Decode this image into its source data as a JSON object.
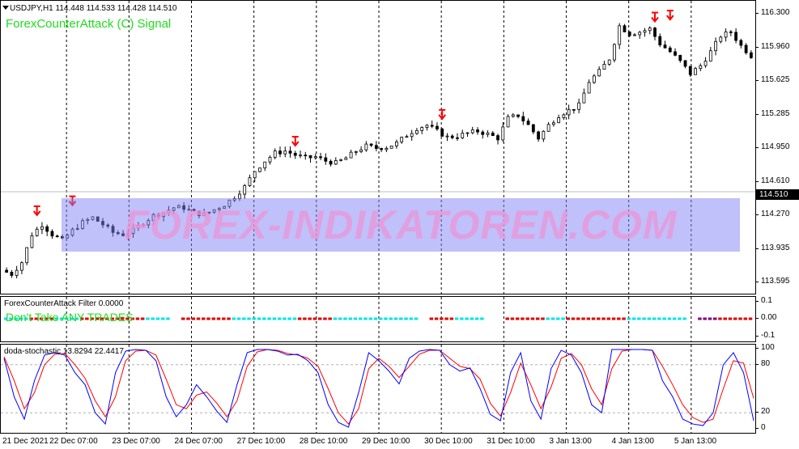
{
  "chart": {
    "symbol_title": "USDJPY,H1  114.448 114.533 114.428 114.510",
    "signal_title": "ForexCounterAttack (C) Signal",
    "watermark": "FOREX-INDIKATOREN.COM",
    "current_price": "114.510",
    "price_axis_labels": [
      "116.300",
      "115.960",
      "115.625",
      "115.285",
      "114.950",
      "114.610",
      "114.270",
      "113.935",
      "113.595"
    ]
  },
  "filter": {
    "title": "ForexCounterAttack Filter 0.0000",
    "message": "Don't Take ANY TRADES",
    "axis_labels": [
      "0.1",
      "0.00",
      "-0.1"
    ]
  },
  "stochastic": {
    "title": "doda-stochastic 13.8294 22.4417",
    "axis_labels": [
      "100",
      "80",
      "20",
      "0"
    ]
  },
  "time_axis": {
    "labels": [
      "21 Dec 2021",
      "22 Dec 07:00",
      "23 Dec 07:00",
      "24 Dec 07:00",
      "27 Dec 10:00",
      "28 Dec 10:00",
      "29 Dec 10:00",
      "30 Dec 10:00",
      "31 Dec 10:00",
      "3 Jan 13:00",
      "4 Jan 13:00",
      "5 Jan 13:00"
    ]
  },
  "chart_data": {
    "type": "candlestick",
    "symbol": "USDJPY",
    "timeframe": "H1",
    "ylim": [
      113.5,
      116.4
    ],
    "close_path": [
      [
        0,
        113.72
      ],
      [
        2,
        113.68
      ],
      [
        4,
        113.8
      ],
      [
        6,
        114.08
      ],
      [
        8,
        114.18
      ],
      [
        10,
        114.08
      ],
      [
        12,
        114.02
      ],
      [
        14,
        114.12
      ],
      [
        16,
        114.2
      ],
      [
        18,
        114.25
      ],
      [
        20,
        114.18
      ],
      [
        22,
        114.1
      ],
      [
        24,
        114.08
      ],
      [
        26,
        114.12
      ],
      [
        28,
        114.2
      ],
      [
        30,
        114.27
      ],
      [
        32,
        114.3
      ],
      [
        34,
        114.35
      ],
      [
        36,
        114.35
      ],
      [
        38,
        114.3
      ],
      [
        40,
        114.28
      ],
      [
        42,
        114.33
      ],
      [
        44,
        114.38
      ],
      [
        46,
        114.46
      ],
      [
        48,
        114.56
      ],
      [
        50,
        114.72
      ],
      [
        52,
        114.82
      ],
      [
        54,
        114.9
      ],
      [
        56,
        114.92
      ],
      [
        58,
        114.88
      ],
      [
        60,
        114.85
      ],
      [
        62,
        114.86
      ],
      [
        64,
        114.82
      ],
      [
        66,
        114.8
      ],
      [
        68,
        114.85
      ],
      [
        70,
        114.92
      ],
      [
        72,
        114.97
      ],
      [
        74,
        114.95
      ],
      [
        76,
        114.96
      ],
      [
        78,
        115.0
      ],
      [
        80,
        115.08
      ],
      [
        82,
        115.15
      ],
      [
        84,
        115.18
      ],
      [
        86,
        115.12
      ],
      [
        88,
        115.06
      ],
      [
        90,
        115.07
      ],
      [
        92,
        115.1
      ],
      [
        94,
        115.12
      ],
      [
        96,
        115.09
      ],
      [
        98,
        115.05
      ],
      [
        100,
        115.25
      ],
      [
        102,
        115.28
      ],
      [
        104,
        115.18
      ],
      [
        106,
        115.05
      ],
      [
        108,
        115.18
      ],
      [
        110,
        115.28
      ],
      [
        112,
        115.33
      ],
      [
        114,
        115.38
      ],
      [
        116,
        115.62
      ],
      [
        118,
        115.72
      ],
      [
        120,
        115.85
      ],
      [
        122,
        116.18
      ],
      [
        124,
        116.1
      ],
      [
        126,
        116.12
      ],
      [
        128,
        116.15
      ],
      [
        130,
        116.0
      ],
      [
        132,
        115.92
      ],
      [
        134,
        115.82
      ],
      [
        136,
        115.7
      ],
      [
        138,
        115.78
      ],
      [
        140,
        115.92
      ],
      [
        142,
        116.08
      ],
      [
        144,
        116.12
      ],
      [
        146,
        115.98
      ],
      [
        148,
        115.88
      ]
    ],
    "sell_signal_arrows": [
      {
        "bar": 6,
        "price": 114.25
      },
      {
        "bar": 13,
        "price": 114.35
      },
      {
        "bar": 57,
        "price": 114.95
      },
      {
        "bar": 86,
        "price": 115.22
      },
      {
        "bar": 128,
        "price": 116.2
      },
      {
        "bar": 131,
        "price": 116.22
      }
    ],
    "filter_segments": [
      {
        "from": 0,
        "to": 5,
        "state": "cyan"
      },
      {
        "from": 5,
        "to": 10,
        "state": "red"
      },
      {
        "from": 10,
        "to": 15,
        "state": "cyan"
      },
      {
        "from": 15,
        "to": 28,
        "state": "red"
      },
      {
        "from": 28,
        "to": 33,
        "state": "cyan"
      },
      {
        "from": 35,
        "to": 45,
        "state": "red"
      },
      {
        "from": 45,
        "to": 58,
        "state": "cyan"
      },
      {
        "from": 58,
        "to": 65,
        "state": "red"
      },
      {
        "from": 65,
        "to": 82,
        "state": "cyan"
      },
      {
        "from": 84,
        "to": 89,
        "state": "red"
      },
      {
        "from": 89,
        "to": 95,
        "state": "cyan"
      },
      {
        "from": 99,
        "to": 107,
        "state": "red"
      },
      {
        "from": 107,
        "to": 111,
        "state": "cyan"
      },
      {
        "from": 111,
        "to": 123,
        "state": "red"
      },
      {
        "from": 123,
        "to": 135,
        "state": "cyan"
      },
      {
        "from": 137,
        "to": 141,
        "state": "purple"
      },
      {
        "from": 141,
        "to": 148,
        "state": "red"
      }
    ],
    "stochastic_main": [
      [
        0,
        88
      ],
      [
        2,
        40
      ],
      [
        4,
        12
      ],
      [
        6,
        60
      ],
      [
        8,
        92
      ],
      [
        10,
        95
      ],
      [
        12,
        92
      ],
      [
        14,
        70
      ],
      [
        16,
        55
      ],
      [
        18,
        20
      ],
      [
        20,
        6
      ],
      [
        22,
        70
      ],
      [
        24,
        97
      ],
      [
        26,
        99
      ],
      [
        28,
        98
      ],
      [
        30,
        85
      ],
      [
        32,
        40
      ],
      [
        34,
        15
      ],
      [
        36,
        30
      ],
      [
        38,
        55
      ],
      [
        40,
        40
      ],
      [
        42,
        22
      ],
      [
        44,
        8
      ],
      [
        46,
        55
      ],
      [
        48,
        95
      ],
      [
        50,
        99
      ],
      [
        52,
        99
      ],
      [
        54,
        97
      ],
      [
        56,
        92
      ],
      [
        58,
        93
      ],
      [
        60,
        85
      ],
      [
        62,
        70
      ],
      [
        64,
        30
      ],
      [
        66,
        8
      ],
      [
        68,
        2
      ],
      [
        70,
        45
      ],
      [
        72,
        95
      ],
      [
        74,
        85
      ],
      [
        76,
        72
      ],
      [
        78,
        56
      ],
      [
        80,
        88
      ],
      [
        82,
        97
      ],
      [
        84,
        99
      ],
      [
        86,
        98
      ],
      [
        88,
        80
      ],
      [
        90,
        72
      ],
      [
        92,
        76
      ],
      [
        94,
        50
      ],
      [
        96,
        18
      ],
      [
        98,
        10
      ],
      [
        100,
        70
      ],
      [
        102,
        95
      ],
      [
        104,
        35
      ],
      [
        106,
        12
      ],
      [
        108,
        75
      ],
      [
        110,
        98
      ],
      [
        112,
        92
      ],
      [
        114,
        70
      ],
      [
        116,
        30
      ],
      [
        118,
        20
      ],
      [
        120,
        99
      ],
      [
        122,
        99
      ],
      [
        124,
        99
      ],
      [
        126,
        99
      ],
      [
        128,
        98
      ],
      [
        130,
        60
      ],
      [
        132,
        40
      ],
      [
        134,
        12
      ],
      [
        136,
        6
      ],
      [
        138,
        4
      ],
      [
        140,
        20
      ],
      [
        142,
        80
      ],
      [
        144,
        95
      ],
      [
        146,
        70
      ],
      [
        148,
        10
      ]
    ],
    "stochastic_signal": [
      [
        0,
        90
      ],
      [
        2,
        60
      ],
      [
        4,
        25
      ],
      [
        6,
        45
      ],
      [
        8,
        80
      ],
      [
        10,
        93
      ],
      [
        12,
        94
      ],
      [
        14,
        80
      ],
      [
        16,
        63
      ],
      [
        18,
        35
      ],
      [
        20,
        15
      ],
      [
        22,
        40
      ],
      [
        24,
        85
      ],
      [
        26,
        97
      ],
      [
        28,
        98
      ],
      [
        30,
        92
      ],
      [
        32,
        62
      ],
      [
        34,
        30
      ],
      [
        36,
        25
      ],
      [
        38,
        42
      ],
      [
        40,
        46
      ],
      [
        42,
        32
      ],
      [
        44,
        15
      ],
      [
        46,
        35
      ],
      [
        48,
        78
      ],
      [
        50,
        96
      ],
      [
        52,
        99
      ],
      [
        54,
        98
      ],
      [
        56,
        94
      ],
      [
        58,
        92
      ],
      [
        60,
        88
      ],
      [
        62,
        78
      ],
      [
        64,
        50
      ],
      [
        66,
        20
      ],
      [
        68,
        6
      ],
      [
        70,
        25
      ],
      [
        72,
        75
      ],
      [
        74,
        88
      ],
      [
        76,
        78
      ],
      [
        78,
        64
      ],
      [
        80,
        78
      ],
      [
        82,
        93
      ],
      [
        84,
        98
      ],
      [
        86,
        98
      ],
      [
        88,
        88
      ],
      [
        90,
        78
      ],
      [
        92,
        75
      ],
      [
        94,
        62
      ],
      [
        96,
        32
      ],
      [
        98,
        16
      ],
      [
        100,
        45
      ],
      [
        102,
        82
      ],
      [
        104,
        55
      ],
      [
        106,
        25
      ],
      [
        108,
        52
      ],
      [
        110,
        88
      ],
      [
        112,
        94
      ],
      [
        114,
        80
      ],
      [
        116,
        50
      ],
      [
        118,
        30
      ],
      [
        120,
        75
      ],
      [
        122,
        97
      ],
      [
        124,
        99
      ],
      [
        126,
        99
      ],
      [
        128,
        98
      ],
      [
        130,
        78
      ],
      [
        132,
        55
      ],
      [
        134,
        30
      ],
      [
        136,
        14
      ],
      [
        138,
        8
      ],
      [
        140,
        12
      ],
      [
        142,
        50
      ],
      [
        144,
        85
      ],
      [
        146,
        82
      ],
      [
        148,
        38
      ]
    ]
  },
  "colors": {
    "bull_candle": "#ffffff",
    "bear_candle": "#000000",
    "signal_arrow": "#ff0000",
    "text_green": "#1edc1e",
    "filter_cyan": "#00e5e5",
    "filter_red": "#e00000",
    "filter_purple": "#800080",
    "stoch_main": "#0000ff",
    "stoch_signal": "#ff0000",
    "watermark_band": "#8282f5",
    "watermark_text": "#eb96d7"
  }
}
